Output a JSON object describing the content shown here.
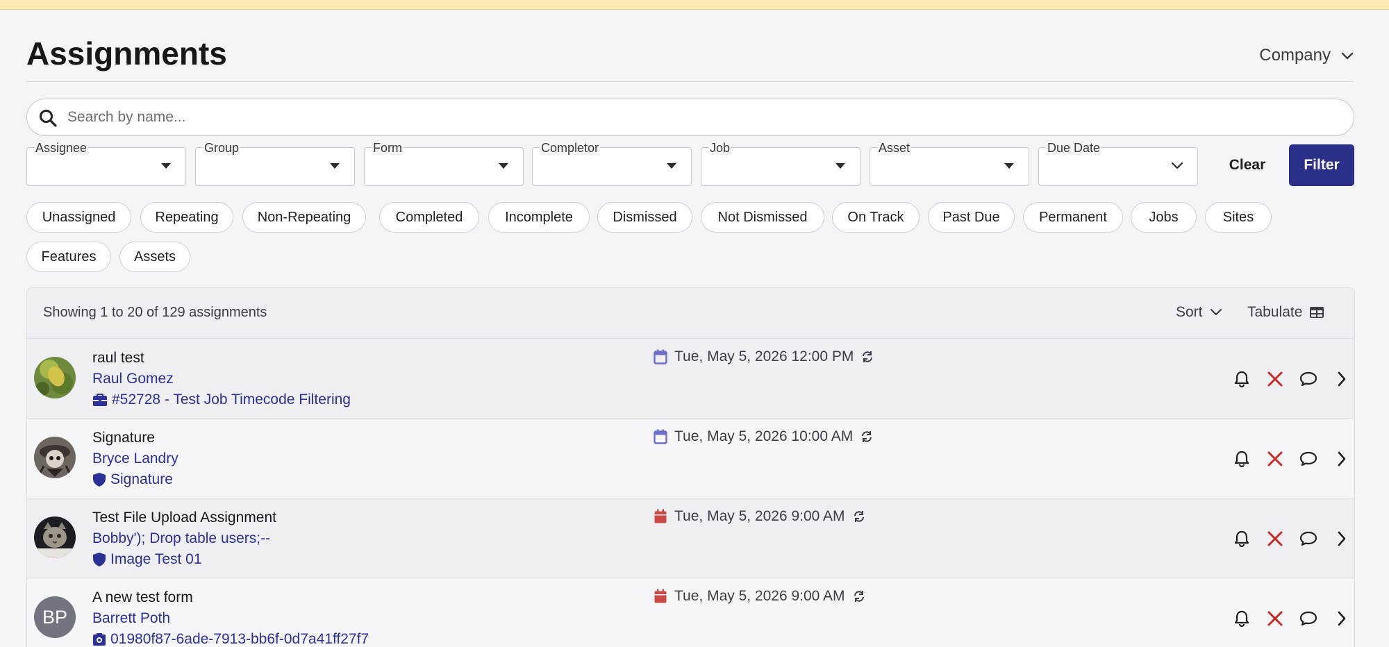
{
  "page": {
    "title": "Assignments",
    "company_label": "Company"
  },
  "search": {
    "placeholder": "Search by name..."
  },
  "filters": [
    {
      "label": "Assignee"
    },
    {
      "label": "Group"
    },
    {
      "label": "Form"
    },
    {
      "label": "Completor"
    },
    {
      "label": "Job"
    },
    {
      "label": "Asset"
    },
    {
      "label": "Due Date"
    }
  ],
  "buttons": {
    "clear": "Clear",
    "filter": "Filter"
  },
  "chips": [
    "Unassigned",
    "Repeating",
    "Non-Repeating",
    "Completed",
    "Incomplete",
    "Dismissed",
    "Not Dismissed",
    "On Track",
    "Past Due",
    "Permanent",
    "Jobs",
    "Sites",
    "Features",
    "Assets"
  ],
  "list": {
    "count_text": "Showing 1 to 20 of 129 assignments",
    "sort_label": "Sort",
    "tabulate_label": "Tabulate",
    "rows": [
      {
        "title": "raul test",
        "user": "Raul Gomez",
        "meta": "#52728 - Test Job Timecode Filtering",
        "meta_icon": "briefcase-icon",
        "date": "Tue, May 5, 2026 12:00 PM",
        "date_color": "#6b6fc9",
        "avatar": "leaf-photo"
      },
      {
        "title": "Signature",
        "user": "Bryce Landry",
        "meta": "Signature",
        "meta_icon": "shield-icon",
        "date": "Tue, May 5, 2026 10:00 AM",
        "date_color": "#6b6fc9",
        "avatar": "cartoon-photo"
      },
      {
        "title": "Test File Upload Assignment",
        "user": "Bobby'); Drop table users;--",
        "meta": "Image Test 01",
        "meta_icon": "shield-icon",
        "date": "Tue, May 5, 2026 9:00 AM",
        "date_color": "#c94a45",
        "avatar": "cat-photo"
      },
      {
        "title": "A new test form",
        "user": "Barrett Poth",
        "meta": "01980f87-6ade-7913-bb6f-0d7a41ff27f7",
        "meta_icon": "camera-box-icon",
        "date": "Tue, May 5, 2026 9:00 AM",
        "date_color": "#c94a45",
        "avatar_initials": "BP"
      }
    ]
  },
  "colors": {
    "accent": "#2c2f8a",
    "link": "#2c3196",
    "dismiss": "#c62a25",
    "overdue": "#c94a45",
    "ontrack": "#6b6fc9"
  }
}
